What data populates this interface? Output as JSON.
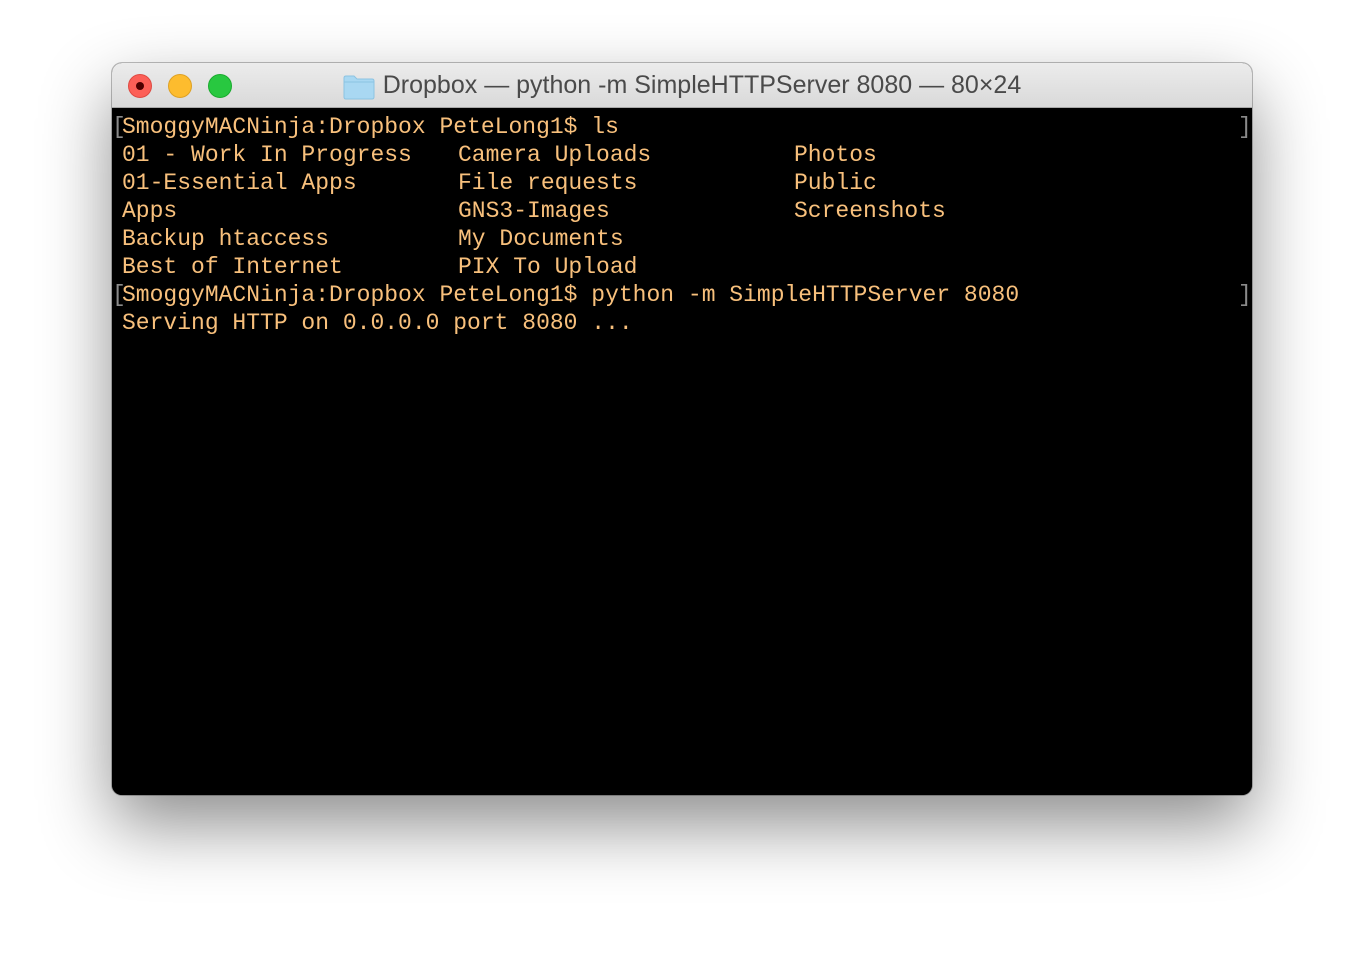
{
  "window": {
    "title": "Dropbox — python -m SimpleHTTPServer 8080 — 80×24"
  },
  "terminal": {
    "prompt1": "SmoggyMACNinja:Dropbox PeteLong1$ ls",
    "listing": {
      "col1": [
        "01 - Work In Progress",
        "01-Essential Apps",
        "Apps",
        "Backup htaccess",
        "Best of Internet"
      ],
      "col2": [
        "Camera Uploads",
        "File requests",
        "GNS3-Images",
        "My Documents",
        "PIX To Upload"
      ],
      "col3": [
        "Photos",
        "Public",
        "Screenshots"
      ]
    },
    "prompt2": "SmoggyMACNinja:Dropbox PeteLong1$ python -m SimpleHTTPServer 8080",
    "output": "Serving HTTP on 0.0.0.0 port 8080 ...",
    "bracket_open": "[",
    "bracket_close": "]"
  },
  "colors": {
    "text": "#f8c07c",
    "background": "#000000"
  }
}
